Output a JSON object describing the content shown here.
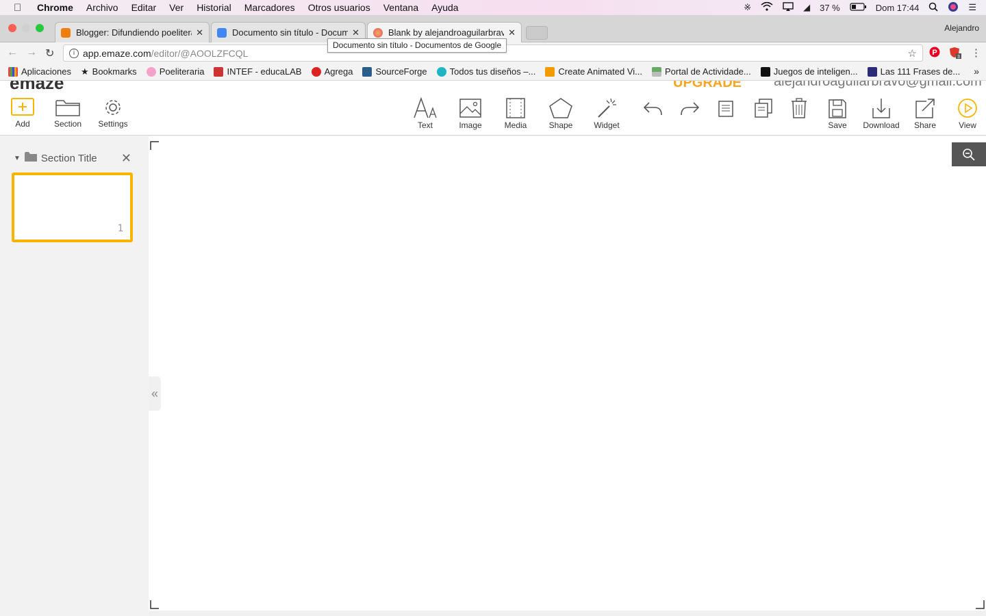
{
  "menubar": {
    "app": "Chrome",
    "menus": [
      "Archivo",
      "Editar",
      "Ver",
      "Historial",
      "Marcadores",
      "Otros usuarios",
      "Ventana",
      "Ayuda"
    ],
    "battery": "37 %",
    "clock": "Dom 17:44"
  },
  "tabs": [
    {
      "title": "Blogger: Difundiendo poeliteraria"
    },
    {
      "title": "Documento sin título - Documentos de Google"
    },
    {
      "title": "Blank by alejandroaguilarbravo"
    }
  ],
  "profile": "Alejandro",
  "tooltip": "Documento sin título - Documentos de Google",
  "omnibox": {
    "host": "app.emaze.com",
    "path": "/editor/@AOOLZFCQL"
  },
  "bookmarks": [
    "Aplicaciones",
    "Bookmarks",
    "Poeliteraria",
    "INTEF - educaLAB",
    "Agrega",
    "SourceForge",
    "Todos tus diseños –...",
    "Create Animated Vi...",
    "Portal de Actividade...",
    "Juegos de inteligen...",
    "Las 111 Frases de..."
  ],
  "app": {
    "logo": "emaze",
    "upgrade": "UPGRADE",
    "email": "alejandroaguilarbravo@gmail.com"
  },
  "toolbar": {
    "add": "Add",
    "section": "Section",
    "settings": "Settings",
    "text": "Text",
    "image": "Image",
    "media": "Media",
    "shape": "Shape",
    "widget": "Widget",
    "save": "Save",
    "download": "Download",
    "share": "Share",
    "view": "View"
  },
  "sidebar": {
    "section_title": "Section Title",
    "slide_number": "1"
  },
  "colors": {
    "accent": "#f7b500",
    "upgrade": "#f5a623"
  }
}
